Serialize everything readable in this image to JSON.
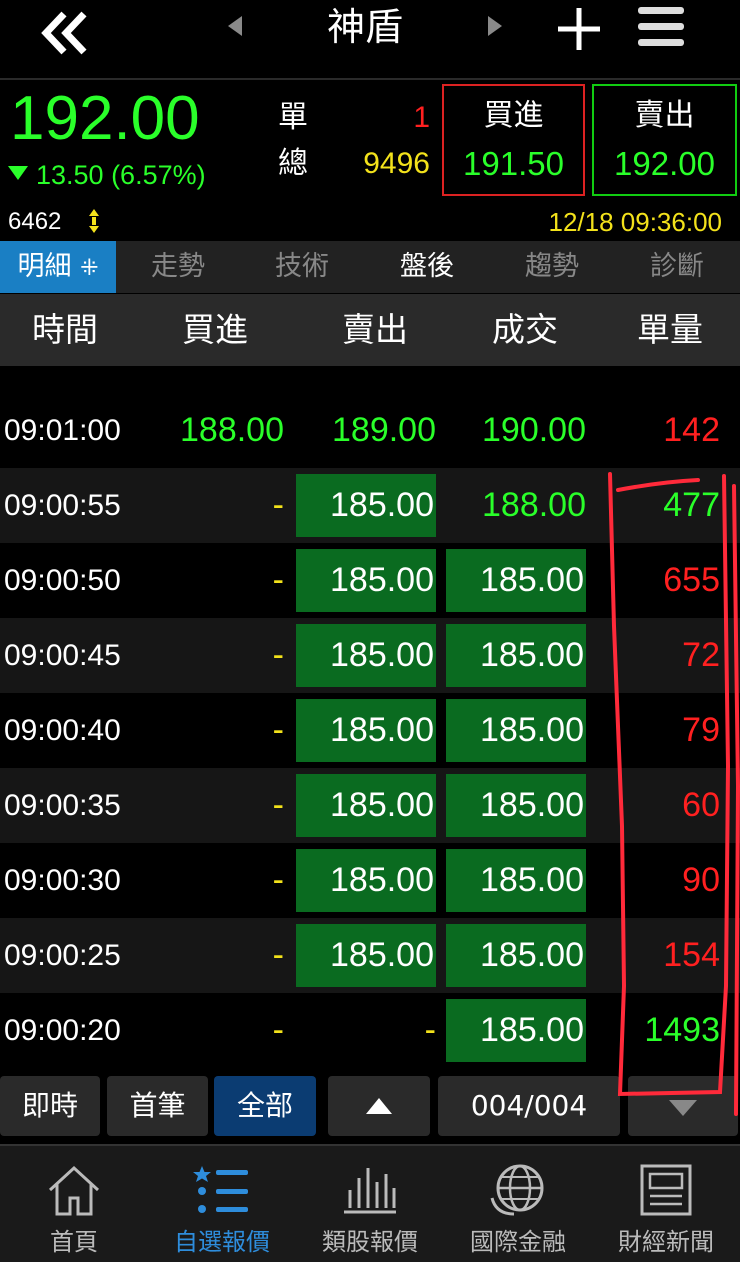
{
  "topbar": {
    "title": "神盾"
  },
  "quote": {
    "price": "192.00",
    "change": "13.50 (6.57%)",
    "single_label": "單",
    "single_value": "1",
    "total_label": "總",
    "total_value": "9496",
    "buy_label": "買進",
    "buy_price": "191.50",
    "sell_label": "賣出",
    "sell_price": "192.00",
    "volume": "6462",
    "datetime": "12/18 09:36:00"
  },
  "tabs": [
    "明細",
    "走勢",
    "技術",
    "盤後",
    "趨勢",
    "診斷"
  ],
  "table": {
    "headers": [
      "時間",
      "買進",
      "賣出",
      "成交",
      "單量"
    ],
    "rows": [
      {
        "time": "09:01:00",
        "buy": "188.00",
        "sell": "189.00",
        "deal": "190.00",
        "qty": "142"
      },
      {
        "time": "09:00:55",
        "buy": "-",
        "sell": "185.00",
        "deal": "188.00",
        "qty": "477"
      },
      {
        "time": "09:00:50",
        "buy": "-",
        "sell": "185.00",
        "deal": "185.00",
        "qty": "655"
      },
      {
        "time": "09:00:45",
        "buy": "-",
        "sell": "185.00",
        "deal": "185.00",
        "qty": "72"
      },
      {
        "time": "09:00:40",
        "buy": "-",
        "sell": "185.00",
        "deal": "185.00",
        "qty": "79"
      },
      {
        "time": "09:00:35",
        "buy": "-",
        "sell": "185.00",
        "deal": "185.00",
        "qty": "60"
      },
      {
        "time": "09:00:30",
        "buy": "-",
        "sell": "185.00",
        "deal": "185.00",
        "qty": "90"
      },
      {
        "time": "09:00:25",
        "buy": "-",
        "sell": "185.00",
        "deal": "185.00",
        "qty": "154"
      },
      {
        "time": "09:00:20",
        "buy": "-",
        "sell": "-",
        "deal": "185.00",
        "qty": "1493"
      }
    ]
  },
  "controls": {
    "realtime": "即時",
    "first": "首筆",
    "all": "全部",
    "page": "004/004"
  },
  "bottom_nav": [
    "首頁",
    "自選報價",
    "類股報價",
    "國際金融",
    "財經新聞"
  ],
  "colors": {
    "up_green": "#2aff2a",
    "down_red": "#ff2020",
    "accent_blue": "#1a7fc4",
    "yellow": "#f3e21b"
  }
}
